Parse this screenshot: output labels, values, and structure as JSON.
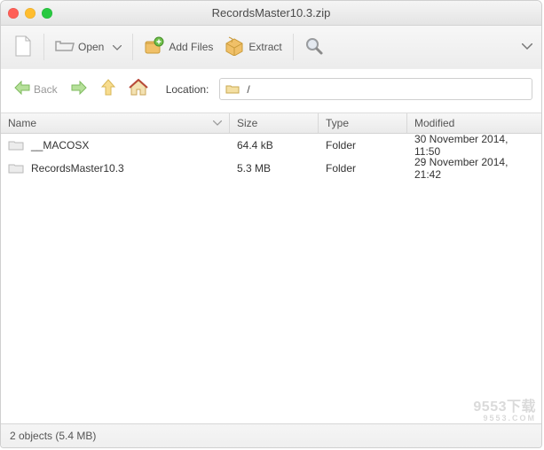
{
  "titlebar": {
    "title": "RecordsMaster10.3.zip"
  },
  "toolbar": {
    "open_label": "Open",
    "addfiles_label": "Add Files",
    "extract_label": "Extract"
  },
  "nav": {
    "back_label": "Back",
    "location_label": "Location:",
    "location_value": "/"
  },
  "columns": {
    "name": "Name",
    "size": "Size",
    "type": "Type",
    "modified": "Modified"
  },
  "rows": [
    {
      "name": "__MACOSX",
      "size": "64.4 kB",
      "type": "Folder",
      "modified": "30 November 2014, 11:50"
    },
    {
      "name": "RecordsMaster10.3",
      "size": "5.3 MB",
      "type": "Folder",
      "modified": "29 November 2014, 21:42"
    }
  ],
  "status": "2 objects (5.4 MB)",
  "watermark": {
    "main": "9553下载",
    "sub": "9553.COM"
  }
}
